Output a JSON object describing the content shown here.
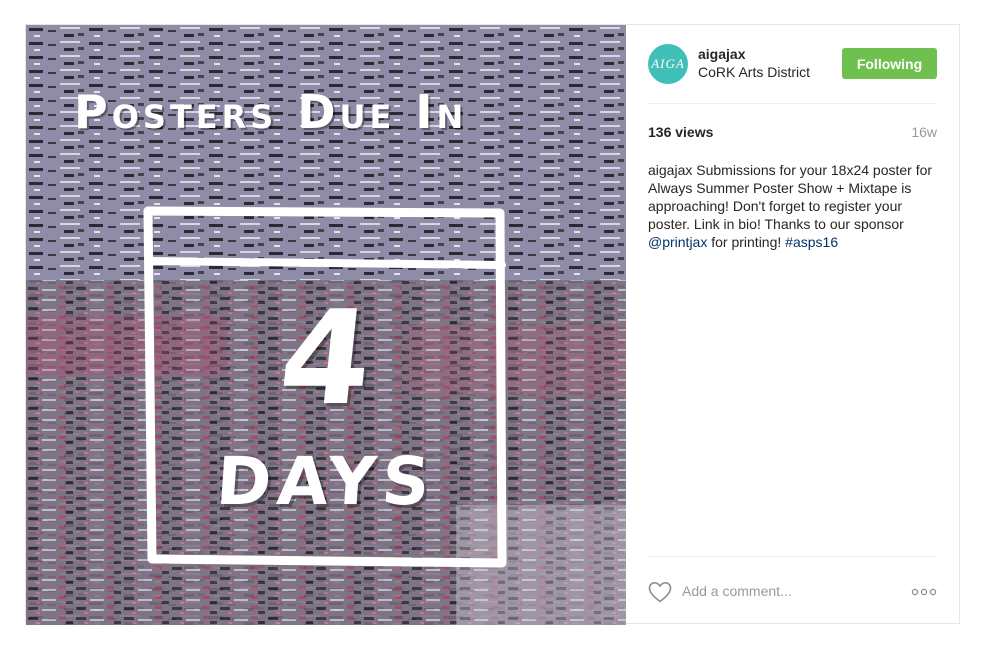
{
  "post": {
    "image": {
      "headline": "Posters Due In",
      "count": "4",
      "unit": "DAYS",
      "background_color": "#8d8aa6"
    },
    "header": {
      "avatar_text": "AIGA",
      "avatar_color": "#3fbfb5",
      "username": "aigajax",
      "location": "CoRK Arts District",
      "follow_label": "Following",
      "follow_color": "#70c050"
    },
    "stats": {
      "views": "136 views",
      "age": "16w"
    },
    "caption": {
      "username": "aigajax",
      "text_before": " Submissions for your 18x24 poster for Always Summer Poster Show + Mixtape is approaching! Don't forget to register your poster. Link in bio! Thanks to our sponsor ",
      "mention": "@printjax",
      "text_middle": " for printing! ",
      "hashtag": "#asps16"
    },
    "footer": {
      "like_icon": "heart-outline-icon",
      "comment_placeholder": "Add a comment...",
      "more_icon": "ellipsis-icon"
    }
  }
}
